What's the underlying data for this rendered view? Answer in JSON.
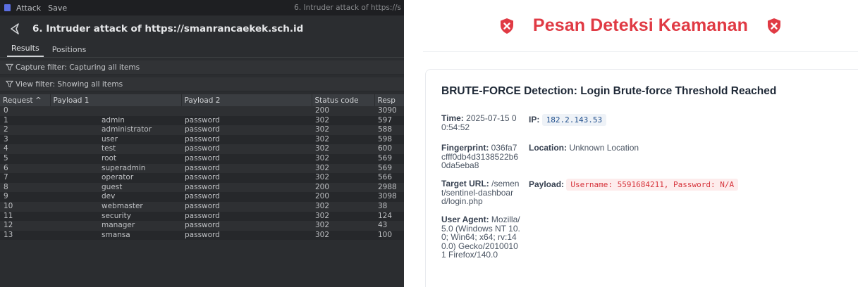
{
  "burp": {
    "menu": [
      "Attack",
      "Save"
    ],
    "window_title": "6. Intruder attack of https://s",
    "title": "6. Intruder attack of https://smanrancaekek.sch.id",
    "tabs": [
      "Results",
      "Positions"
    ],
    "capture_filter": "Capture filter: Capturing all items",
    "view_filter": "View filter: Showing all items",
    "columns": [
      "Request ^",
      "Payload 1",
      "Payload 2",
      "Status code",
      "Resp"
    ],
    "rows": [
      {
        "req": "0",
        "p1": "",
        "p2": "",
        "status": "200",
        "resp": "3090"
      },
      {
        "req": "1",
        "p1": "admin",
        "p2": "password",
        "status": "302",
        "resp": "597"
      },
      {
        "req": "2",
        "p1": "administrator",
        "p2": "password",
        "status": "302",
        "resp": "588"
      },
      {
        "req": "3",
        "p1": "user",
        "p2": "password",
        "status": "302",
        "resp": "598"
      },
      {
        "req": "4",
        "p1": "test",
        "p2": "password",
        "status": "302",
        "resp": "600"
      },
      {
        "req": "5",
        "p1": "root",
        "p2": "password",
        "status": "302",
        "resp": "569"
      },
      {
        "req": "6",
        "p1": "superadmin",
        "p2": "password",
        "status": "302",
        "resp": "569"
      },
      {
        "req": "7",
        "p1": "operator",
        "p2": "password",
        "status": "302",
        "resp": "566"
      },
      {
        "req": "8",
        "p1": "guest",
        "p2": "password",
        "status": "200",
        "resp": "2988"
      },
      {
        "req": "9",
        "p1": "dev",
        "p2": "password",
        "status": "200",
        "resp": "3098"
      },
      {
        "req": "10",
        "p1": "webmaster",
        "p2": "password",
        "status": "302",
        "resp": "38"
      },
      {
        "req": "11",
        "p1": "security",
        "p2": "password",
        "status": "302",
        "resp": "124"
      },
      {
        "req": "12",
        "p1": "manager",
        "p2": "password",
        "status": "302",
        "resp": "43"
      },
      {
        "req": "13",
        "p1": "smansa",
        "p2": "password",
        "status": "302",
        "resp": "100"
      }
    ]
  },
  "security": {
    "heading": "Pesan Deteksi Keamanan",
    "card_title": "BRUTE-FORCE Detection: Login Brute-force Threshold Reached",
    "time_label": "Time:",
    "time_value": "2025-07-15 00:54:52",
    "fingerprint_label": "Fingerprint:",
    "fingerprint_value": "036fa7cfff0db4d3138522b60da5eba8",
    "target_label": "Target URL:",
    "target_value": "/sement/sentinel-dashboard/login.php",
    "ua_label": "User Agent:",
    "ua_value": "Mozilla/5.0 (Windows NT 10.0; Win64; x64; rv:140.0) Gecko/20100101 Firefox/140.0",
    "ip_label": "IP:",
    "ip_value": "182.2.143.53",
    "location_label": "Location:",
    "location_value": "Unknown Location",
    "payload_label": "Payload:",
    "payload_value": "Username: 5591684211, Password: N/A"
  },
  "colors": {
    "burp_bg": "#2b2d30",
    "alert_red": "#e03a44",
    "payload_red": "#d6333b",
    "ip_blue": "#1f4e8c"
  }
}
